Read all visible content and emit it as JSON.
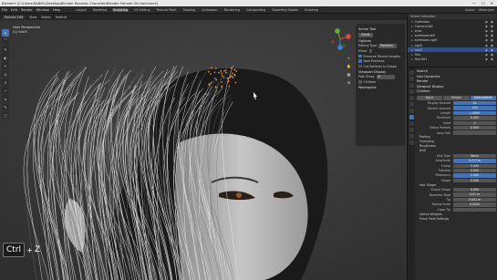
{
  "titlebar": {
    "title": "Blender* [C:\\Users\\DANIEL\\Desktop\\Blender Realistic Character\\Blender Female Girl.hair.blend]",
    "controls": [
      "—",
      "☐",
      "✕"
    ]
  },
  "menubar": {
    "menus": [
      "File",
      "Edit",
      "Render",
      "Window",
      "Help"
    ],
    "workspaces": [
      "Layout",
      "Modeling",
      "Sculpting",
      "UV Editing",
      "Texture Paint",
      "Shading",
      "Animation",
      "Rendering",
      "Compositing",
      "Geometry Nodes",
      "Scripting"
    ],
    "active_workspace": "Sculpting",
    "right": [
      "Scene",
      "ViewLayer"
    ]
  },
  "vp_header": {
    "mode": "Particle Edit",
    "items": [
      "View",
      "Select",
      "Particle"
    ]
  },
  "toolbar": {
    "tools": [
      "↖",
      "⌒",
      "✎",
      "◐",
      "✂",
      "◎",
      "⇕",
      "✧",
      "⌀",
      "✎",
      "▢"
    ]
  },
  "viewport": {
    "view_name": "User Perspective",
    "collection": "(1) hair3"
  },
  "n_panel": {
    "active_tool": "Active Tool",
    "brush_name": "Comb",
    "options": "Options",
    "editing_type": "Editing Type",
    "editing_value": "Particles",
    "mirror": "Mirror",
    "preserve_strand": "Preserve Strand Lengths",
    "root_positions": "Root Positions",
    "cut_particles": "Cut Particles to Shape",
    "viewport_display": "Viewport Display",
    "path_steps": "Path Steps",
    "path_steps_value": "6",
    "children": "Children",
    "workspace": "Workspace"
  },
  "nav": [
    "⌕",
    "✋",
    "▦",
    "⊕"
  ],
  "overlay": {
    "ctrl": "Ctrl",
    "plus": "+",
    "z": "Z"
  },
  "watermark": "Udemy",
  "outliner": {
    "header": "Scene Collection",
    "rows": [
      {
        "name": "Collection",
        "icon": "▾"
      },
      {
        "name": "Camera.001",
        "icon": "▸"
      },
      {
        "name": "eyes",
        "icon": "▸"
      },
      {
        "name": "eyebrows.left",
        "icon": "▸"
      },
      {
        "name": "eyebrows.right",
        "icon": "▸"
      },
      {
        "name": "Light",
        "icon": "▸"
      },
      {
        "name": "hair3",
        "icon": "▸"
      },
      {
        "name": "Hair",
        "icon": "▸"
      },
      {
        "name": "Hair.001",
        "icon": "▸"
      }
    ]
  },
  "props": {
    "search": "Search",
    "hair_dynamics": "Hair Dynamics",
    "render": "Render",
    "viewport_display": "Viewport Display",
    "children": "Children",
    "children_modes": [
      "None",
      "Simple",
      "Interpolated"
    ],
    "children_active": "Interpolated",
    "fields": [
      {
        "label": "Display Amount",
        "value": "50"
      },
      {
        "label": "Render Amount",
        "value": "100"
      },
      {
        "label": "Length",
        "value": "1.0000"
      },
      {
        "label": "Threshold",
        "value": "0.000"
      },
      {
        "label": "Seed",
        "value": "0"
      },
      {
        "label": "Virtual Parents",
        "value": "0.000"
      },
      {
        "label": "Long Hair",
        "value": ""
      }
    ],
    "parting": "Parting",
    "clumping": "Clumping",
    "roughness": "Roughness",
    "kink": "Kink",
    "kink_type": {
      "label": "Kink Type",
      "value": "Wave"
    },
    "kink_fields": [
      {
        "label": "Amplitude",
        "value": "0.217 m"
      },
      {
        "label": "Clump",
        "value": "0.000"
      },
      {
        "label": "Flatness",
        "value": "0.000"
      },
      {
        "label": "Frequency",
        "value": "2.000"
      },
      {
        "label": "Shape",
        "value": "0.000"
      }
    ],
    "hair_shape": "Hair Shape",
    "shape_fields": [
      {
        "label": "Strand Shape",
        "value": "0.000"
      },
      {
        "label": "Diameter Root",
        "value": "0.01 m"
      },
      {
        "label": "Tip",
        "value": "0.001 m"
      },
      {
        "label": "Radius Scale",
        "value": "0.0000"
      },
      {
        "label": "Close Tip",
        "value": ""
      }
    ],
    "vertex_weights": "Vertex Weights",
    "force_field": "Force Field Settings"
  },
  "colors": {
    "accent": "#4772b3",
    "hair_orange": "#e2893a"
  }
}
